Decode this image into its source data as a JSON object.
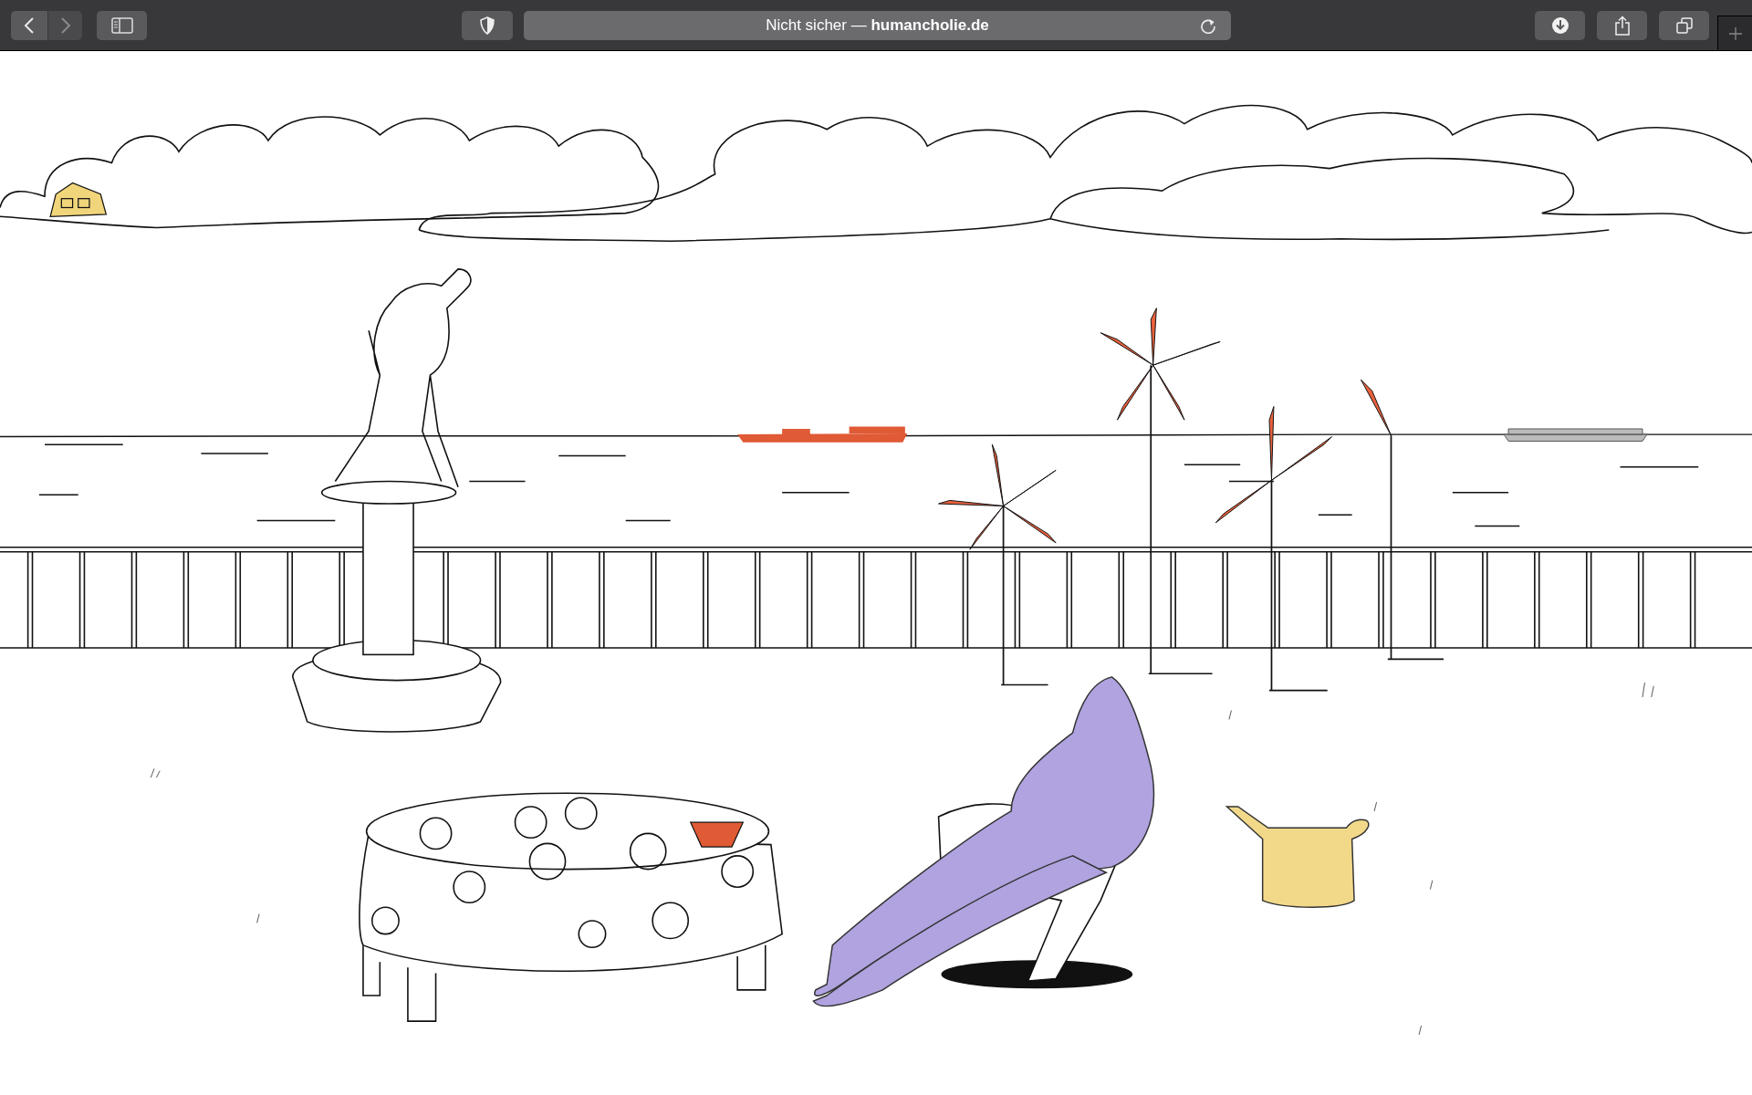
{
  "toolbar": {
    "back": {
      "disabled": false
    },
    "forward": {
      "disabled": true
    },
    "address": {
      "text": "Nicht sicher — **humancholie.de**"
    }
  }
}
